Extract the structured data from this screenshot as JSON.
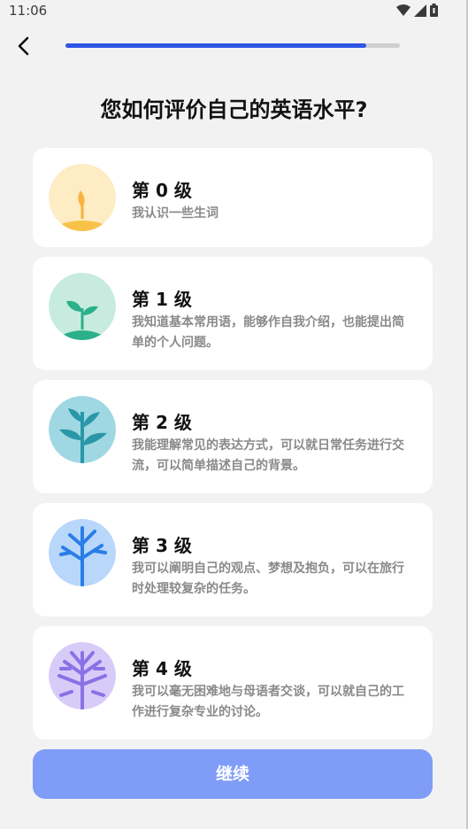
{
  "status": {
    "time": "11:06"
  },
  "progress": {
    "fraction": 0.9
  },
  "title": "您如何评价自己的英语水平?",
  "levels": [
    {
      "label": "第 0 级",
      "desc": "我认识一些生词"
    },
    {
      "label": "第 1 级",
      "desc": "我知道基本常用语，能够作自我介绍，也能提出简单的个人问题。"
    },
    {
      "label": "第 2 级",
      "desc": "我能理解常见的表达方式，可以就日常任务进行交流，可以简单描述自己的背景。"
    },
    {
      "label": "第 3 级",
      "desc": "我可以阐明自己的观点、梦想及抱负，可以在旅行时处理较复杂的任务。"
    },
    {
      "label": "第 4 级",
      "desc": "我可以毫无困难地与母语者交谈，可以就自己的工作进行复杂专业的讨论。"
    }
  ],
  "continue_label": "继续",
  "colors": {
    "accent": "#2f55e6",
    "button": "#7f9cf8"
  }
}
